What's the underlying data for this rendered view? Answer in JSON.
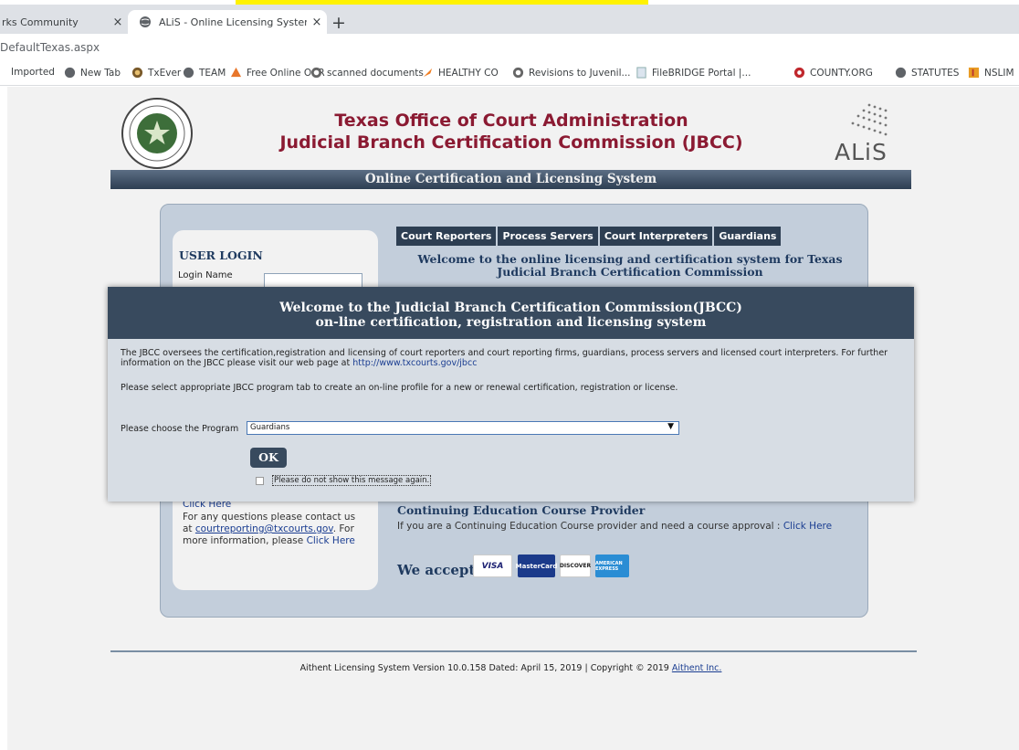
{
  "browser": {
    "tabs": [
      {
        "label": "rks Community",
        "active": false
      },
      {
        "label": "ALiS - Online Licensing System",
        "active": true
      }
    ],
    "new_tab": "+",
    "close_glyph": "×",
    "url": "DefaultTexas.aspx",
    "bookmarks": [
      {
        "label": "Imported",
        "icon": "none"
      },
      {
        "label": "New Tab",
        "icon": "globe-icon"
      },
      {
        "label": "TxEver",
        "icon": "txever-icon"
      },
      {
        "label": "TEAM",
        "icon": "globe-icon"
      },
      {
        "label": "Free Online OCR",
        "icon": "ocr-icon"
      },
      {
        "label": "scanned documents",
        "icon": "scan-icon"
      },
      {
        "label": "HEALTHY CO",
        "icon": "rocket-icon"
      },
      {
        "label": "Revisions to Juvenil...",
        "icon": "scan-icon"
      },
      {
        "label": "FileBRIDGE Portal |...",
        "icon": "file-icon"
      },
      {
        "label": "COUNTY.ORG",
        "icon": "county-icon"
      },
      {
        "label": "STATUTES",
        "icon": "globe-icon"
      },
      {
        "label": "NSLIM",
        "icon": "nslim-icon"
      }
    ]
  },
  "header": {
    "title_line1": "Texas Office of Court Administration",
    "title_line2": "Judicial Branch Certification Commission (JBCC)",
    "logo_text": "ALiS",
    "navbar": "Online Certification and Licensing System"
  },
  "login": {
    "title": "USER LOGIN",
    "login_name_label": "Login Name"
  },
  "program_tabs": [
    "Court Reporters",
    "Process Servers",
    "Court Interpreters",
    "Guardians"
  ],
  "welcome": {
    "line1": "Welcome to the online licensing and certification system for Texas",
    "line2": "Judicial Branch Certification Commission"
  },
  "contact": {
    "click_here_cut": "Click Here",
    "text_before": "For any questions please contact us at ",
    "email": "courtreporting@txcourts.gov",
    "text_after": ". For more information, please ",
    "link": "Click Here"
  },
  "continuing_ed": {
    "title": "Continuing Education Course Provider",
    "text": "If you are a Continuing Education Course provider and need a course approval : ",
    "link": "Click Here"
  },
  "payment": {
    "label": "We accept:",
    "cards": [
      "VISA",
      "MasterCard",
      "DISCOVER",
      "AMERICAN EXPRESS"
    ]
  },
  "footer": {
    "text": "Aithent Licensing System Version 10.0.158 Dated: April 15, 2019 | Copyright © 2019 ",
    "link": "Aithent Inc."
  },
  "modal": {
    "title_line1": "Welcome to the Judicial Branch Certification Commission(JBCC)",
    "title_line2": "on-line certification, registration and licensing system",
    "para1": "The JBCC oversees the certification,registration and licensing of court reporters and court reporting firms, guardians, process servers and licensed court interpreters. For further information on the JBCC please visit our web page at ",
    "para1_link": "http://www.txcourts.gov/jbcc",
    "para2": "Please select appropriate JBCC program tab to create an on-line profile for a new or renewal certification, registration or license.",
    "choose_label": "Please choose the Program",
    "selected_program": "Guardians",
    "ok_label": "OK",
    "dont_show_label": "Please do not show this message again."
  },
  "colors": {
    "title_maroon": "#8b1a32",
    "navy": "#2d3e52",
    "panel_blue": "#c3cedb",
    "link_blue": "#1a3d91"
  }
}
